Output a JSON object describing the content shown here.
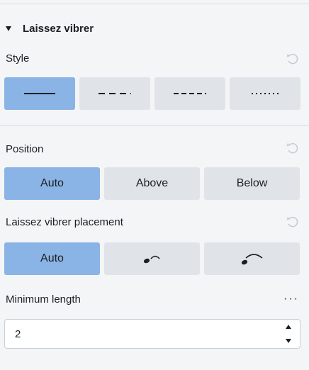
{
  "section": {
    "title": "Laissez vibrer"
  },
  "style": {
    "label": "Style",
    "options": [
      {
        "name": "solid-line-icon",
        "selected": true
      },
      {
        "name": "dashed-line-icon",
        "selected": false
      },
      {
        "name": "wide-dashed-line-icon",
        "selected": false
      },
      {
        "name": "dotted-line-icon",
        "selected": false
      }
    ]
  },
  "position": {
    "label": "Position",
    "options": [
      "Auto",
      "Above",
      "Below"
    ],
    "selected": "Auto"
  },
  "placement": {
    "label": "Laissez vibrer placement",
    "auto_label": "Auto",
    "selected": "Auto",
    "icons": [
      "note-tie-close-icon",
      "note-tie-wide-icon"
    ]
  },
  "minimum_length": {
    "label": "Minimum length",
    "value": "2",
    "more_label": "···"
  },
  "colors": {
    "background": "#f4f5f6",
    "button": "#e0e4e9",
    "button_active": "#8ab4e5",
    "text": "#1c1f24",
    "reset_icon": "#c8ccd2"
  }
}
